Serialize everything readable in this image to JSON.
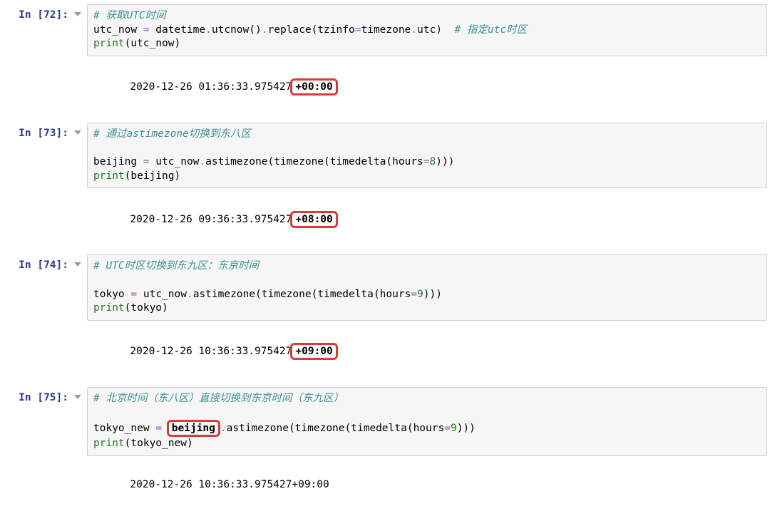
{
  "cells": [
    {
      "prompt": "In [72]:",
      "code": [
        {
          "type": "line",
          "segments": [
            {
              "cls": "c-comment",
              "text": "# 获取UTC时间"
            }
          ]
        },
        {
          "type": "line",
          "segments": [
            {
              "cls": "c-var",
              "text": "utc_now "
            },
            {
              "cls": "c-op",
              "text": "="
            },
            {
              "cls": "c-var",
              "text": " datetime"
            },
            {
              "cls": "c-op",
              "text": "."
            },
            {
              "cls": "c-var",
              "text": "utcnow"
            },
            {
              "cls": "c-paren",
              "text": "()"
            },
            {
              "cls": "c-op",
              "text": "."
            },
            {
              "cls": "c-var",
              "text": "replace"
            },
            {
              "cls": "c-paren",
              "text": "("
            },
            {
              "cls": "c-var",
              "text": "tzinfo"
            },
            {
              "cls": "c-op",
              "text": "="
            },
            {
              "cls": "c-var",
              "text": "timezone"
            },
            {
              "cls": "c-op",
              "text": "."
            },
            {
              "cls": "c-var",
              "text": "utc"
            },
            {
              "cls": "c-paren",
              "text": ")"
            },
            {
              "cls": "c-var",
              "text": "  "
            },
            {
              "cls": "c-comment",
              "text": "# 指定utc时区"
            }
          ]
        },
        {
          "type": "line",
          "segments": [
            {
              "cls": "c-builtin",
              "text": "print"
            },
            {
              "cls": "c-paren",
              "text": "("
            },
            {
              "cls": "c-var",
              "text": "utc_now"
            },
            {
              "cls": "c-paren",
              "text": ")"
            }
          ]
        }
      ],
      "output_pre": "2020-12-26 01:36:33.975427",
      "output_box": "+00:00",
      "output_post": ""
    },
    {
      "prompt": "In [73]:",
      "code": [
        {
          "type": "line",
          "segments": [
            {
              "cls": "c-comment",
              "text": "# 通过astimezone切换到东八区"
            }
          ]
        },
        {
          "type": "blank",
          "segments": []
        },
        {
          "type": "line",
          "segments": [
            {
              "cls": "c-var",
              "text": "beijing "
            },
            {
              "cls": "c-op",
              "text": "="
            },
            {
              "cls": "c-var",
              "text": " utc_now"
            },
            {
              "cls": "c-op",
              "text": "."
            },
            {
              "cls": "c-var",
              "text": "astimezone"
            },
            {
              "cls": "c-paren",
              "text": "("
            },
            {
              "cls": "c-var",
              "text": "timezone"
            },
            {
              "cls": "c-paren",
              "text": "("
            },
            {
              "cls": "c-var",
              "text": "timedelta"
            },
            {
              "cls": "c-paren",
              "text": "("
            },
            {
              "cls": "c-var",
              "text": "hours"
            },
            {
              "cls": "c-op",
              "text": "="
            },
            {
              "cls": "c-num",
              "text": "8"
            },
            {
              "cls": "c-paren",
              "text": ")))"
            }
          ]
        },
        {
          "type": "line",
          "segments": [
            {
              "cls": "c-builtin",
              "text": "print"
            },
            {
              "cls": "c-paren",
              "text": "("
            },
            {
              "cls": "c-var",
              "text": "beijing"
            },
            {
              "cls": "c-paren",
              "text": ")"
            }
          ]
        }
      ],
      "output_pre": "2020-12-26 09:36:33.975427",
      "output_box": "+08:00",
      "output_post": ""
    },
    {
      "prompt": "In [74]:",
      "code": [
        {
          "type": "line",
          "segments": [
            {
              "cls": "c-comment",
              "text": "# UTC时区切换到东九区：东京时间"
            }
          ]
        },
        {
          "type": "blank",
          "segments": []
        },
        {
          "type": "line",
          "segments": [
            {
              "cls": "c-var",
              "text": "tokyo "
            },
            {
              "cls": "c-op",
              "text": "="
            },
            {
              "cls": "c-var",
              "text": " utc_now"
            },
            {
              "cls": "c-op",
              "text": "."
            },
            {
              "cls": "c-var",
              "text": "astimezone"
            },
            {
              "cls": "c-paren",
              "text": "("
            },
            {
              "cls": "c-var",
              "text": "timezone"
            },
            {
              "cls": "c-paren",
              "text": "("
            },
            {
              "cls": "c-var",
              "text": "timedelta"
            },
            {
              "cls": "c-paren",
              "text": "("
            },
            {
              "cls": "c-var",
              "text": "hours"
            },
            {
              "cls": "c-op",
              "text": "="
            },
            {
              "cls": "c-num",
              "text": "9"
            },
            {
              "cls": "c-paren",
              "text": ")))"
            }
          ]
        },
        {
          "type": "line",
          "segments": [
            {
              "cls": "c-builtin",
              "text": "print"
            },
            {
              "cls": "c-paren",
              "text": "("
            },
            {
              "cls": "c-var",
              "text": "tokyo"
            },
            {
              "cls": "c-paren",
              "text": ")"
            }
          ]
        }
      ],
      "output_pre": "2020-12-26 10:36:33.975427",
      "output_box": "+09:00",
      "output_post": ""
    },
    {
      "prompt": "In [75]:",
      "code": [
        {
          "type": "line",
          "segments": [
            {
              "cls": "c-comment",
              "text": "# 北京时间（东八区）直接切换到东京时间（东九区）"
            }
          ]
        },
        {
          "type": "blank",
          "segments": []
        },
        {
          "type": "line",
          "segments": [
            {
              "cls": "c-var",
              "text": "tokyo_new "
            },
            {
              "cls": "c-op",
              "text": "="
            },
            {
              "cls": "c-var",
              "text": " "
            },
            {
              "cls": "c-var",
              "text": "",
              "boxed": true,
              "box_text": "beijing"
            },
            {
              "cls": "c-op",
              "text": "."
            },
            {
              "cls": "c-var",
              "text": "astimezone"
            },
            {
              "cls": "c-paren",
              "text": "("
            },
            {
              "cls": "c-var",
              "text": "timezone"
            },
            {
              "cls": "c-paren",
              "text": "("
            },
            {
              "cls": "c-var",
              "text": "timedelta"
            },
            {
              "cls": "c-paren",
              "text": "("
            },
            {
              "cls": "c-var",
              "text": "hours"
            },
            {
              "cls": "c-op",
              "text": "="
            },
            {
              "cls": "c-num",
              "text": "9"
            },
            {
              "cls": "c-paren",
              "text": ")))"
            }
          ]
        },
        {
          "type": "line",
          "segments": [
            {
              "cls": "c-builtin",
              "text": "print"
            },
            {
              "cls": "c-paren",
              "text": "("
            },
            {
              "cls": "c-var",
              "text": "tokyo_new"
            },
            {
              "cls": "c-paren",
              "text": ")"
            }
          ]
        }
      ],
      "output_pre": "2020-12-26 10:36:33.975427+09:00",
      "output_box": "",
      "output_post": ""
    }
  ]
}
